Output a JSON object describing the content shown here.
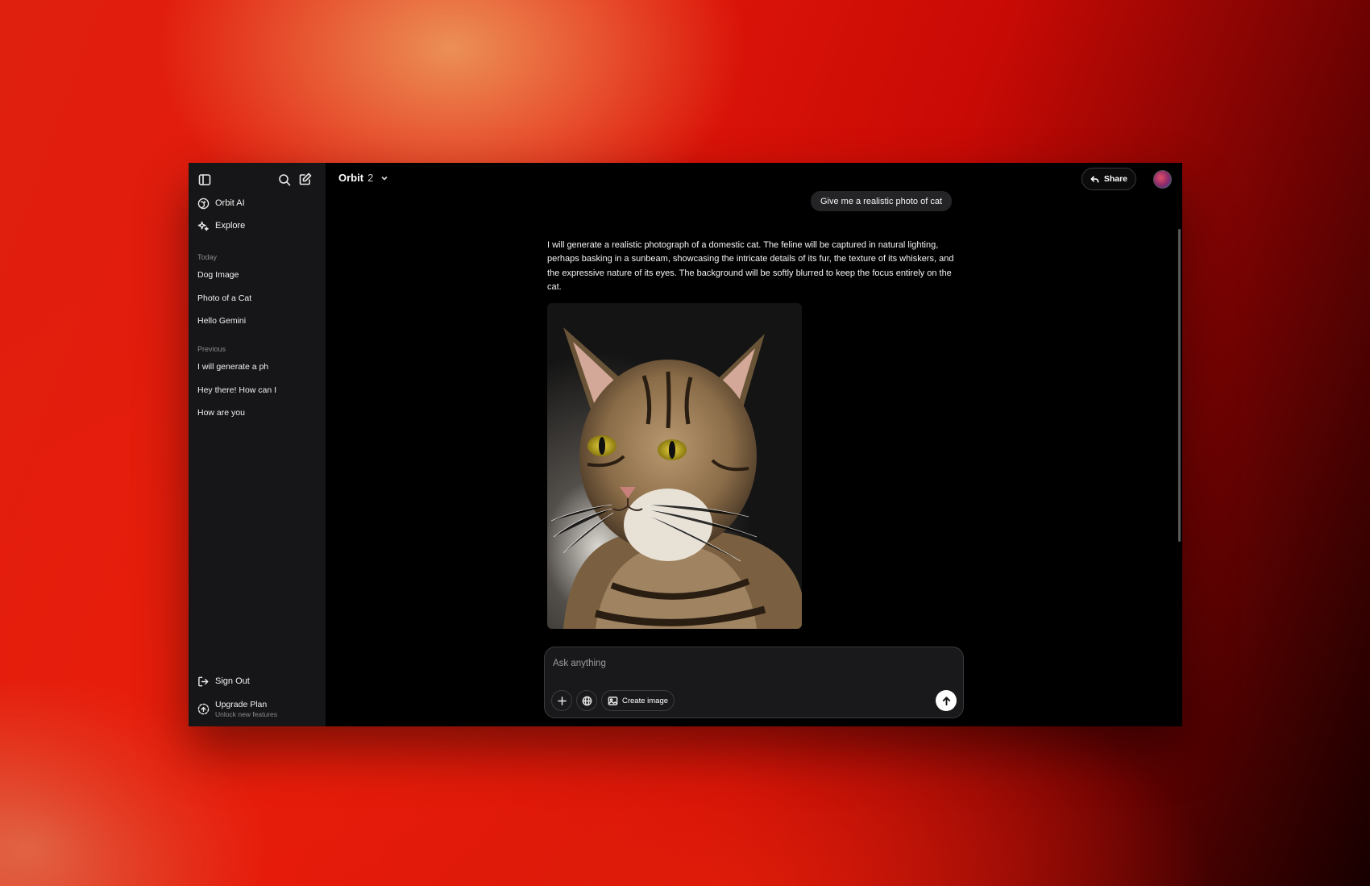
{
  "sidebar": {
    "icons": {
      "toggle": "sidebar-toggle-icon",
      "search": "search-icon",
      "new_chat": "new-chat-icon"
    },
    "nav": [
      {
        "label": "Orbit AI",
        "icon": "orbit-logo-icon"
      },
      {
        "label": "Explore",
        "icon": "sparkle-icon"
      }
    ],
    "today_label": "Today",
    "today": [
      "Dog Image",
      "Photo of a Cat",
      "Hello Gemini"
    ],
    "previous_label": "Previous",
    "previous": [
      "I will generate a ph",
      "Hey there! How can I",
      "How are you"
    ],
    "sign_out": "Sign Out",
    "upgrade": {
      "title": "Upgrade Plan",
      "subtitle": "Unlock new features"
    }
  },
  "header": {
    "model_name": "Orbit",
    "model_version": "2",
    "share_label": "Share"
  },
  "chat": {
    "user_message": "Give me a realistic photo of cat",
    "assistant_message": "I will generate a realistic photograph of a domestic cat. The feline will be captured in natural lighting, perhaps basking in a sunbeam, showcasing the intricate details of its fur, the texture of its whiskers, and the expressive nature of its eyes. The background will be softly blurred to keep the focus entirely on the cat."
  },
  "composer": {
    "placeholder": "Ask anything",
    "create_image_label": "Create image"
  },
  "colors": {
    "app_bg": "#000000",
    "sidebar_bg": "#161618",
    "bubble_bg": "#242426",
    "text": "#f4f4f4",
    "muted": "#8b8b8f"
  }
}
